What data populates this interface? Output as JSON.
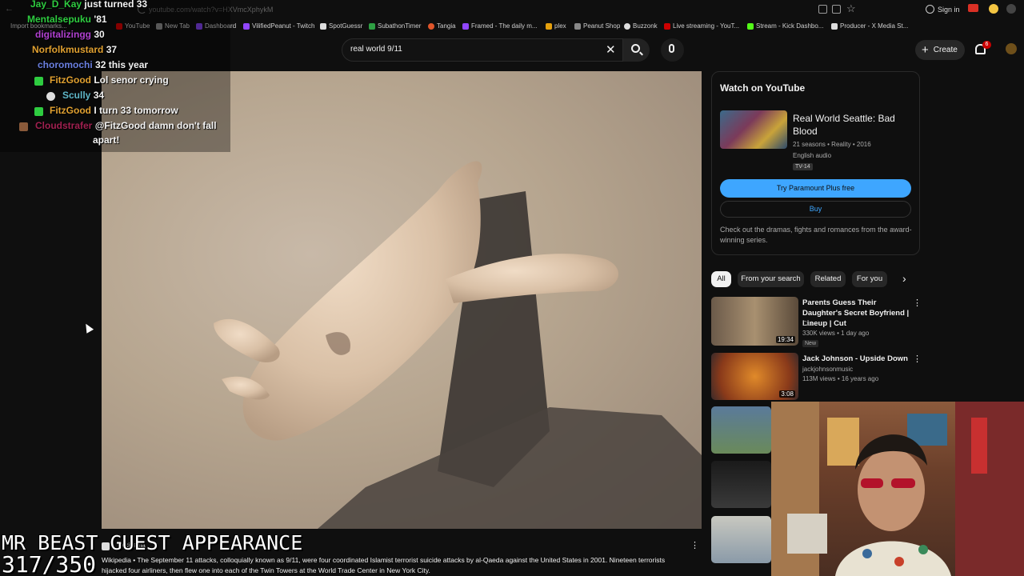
{
  "browser": {
    "url": "youtube.com/watch?v=HXVmcXphykM",
    "signin_label": "Sign in",
    "bookmarks": [
      {
        "label": "Import bookmarks...",
        "color": "#666666"
      },
      {
        "label": "YouTube",
        "color": "#cc0000"
      },
      {
        "label": "New Tab",
        "color": "#888888"
      },
      {
        "label": "Dashboard",
        "color": "#7b3fe4"
      },
      {
        "label": "VilifiedPeanut - Twitch",
        "color": "#9146ff"
      },
      {
        "label": "SpotGuessr",
        "color": "#dddddd"
      },
      {
        "label": "SubathonTimer",
        "color": "#2ea043"
      },
      {
        "label": "Tangia",
        "color": "#e0552a"
      },
      {
        "label": "Framed - The daily m...",
        "color": "#9146ff"
      },
      {
        "label": "plex",
        "color": "#e5a00d"
      },
      {
        "label": "Peanut Shop",
        "color": "#888888"
      },
      {
        "label": "Buzzonk",
        "color": "#dddddd"
      },
      {
        "label": "Live streaming - YouT...",
        "color": "#cc0000"
      },
      {
        "label": "Stream - Kick Dashbo...",
        "color": "#53fc18"
      },
      {
        "label": "Producer - X Media St...",
        "color": "#dddddd"
      }
    ]
  },
  "youtube": {
    "search_value": "real world 9/11",
    "create_label": "Create",
    "notification_count": "6"
  },
  "chat": [
    {
      "user": "Jay_D_Kay",
      "color": "#2ecc40",
      "message": "just turned 33"
    },
    {
      "user": "Mentalsepuku",
      "color": "#2ecc40",
      "message": "'81"
    },
    {
      "user": "digitalizingg",
      "color": "#b040d0",
      "message": "30"
    },
    {
      "user": "Norfolkmustard",
      "color": "#e0a030",
      "message": "37"
    },
    {
      "user": "choromochi",
      "color": "#6a7fe0",
      "message": "32 this year"
    },
    {
      "user": "FitzGood",
      "color": "#e0a030",
      "message": "Lol senor crying"
    },
    {
      "user": "Scully",
      "color": "#5fb6c8",
      "message": "34"
    },
    {
      "user": "FitzGood",
      "color": "#e0a030",
      "message": "I turn 33 tomorrow"
    },
    {
      "user": "Cloudstrafer",
      "color": "#a02050",
      "message": "@FitzGood damn don't fall"
    },
    {
      "user": "",
      "color": "#ffffff",
      "message": "apart!"
    }
  ],
  "watch_card": {
    "heading": "Watch on YouTube",
    "show_title": "Real World Seattle: Bad Blood",
    "meta": "21 seasons • Reality • 2016",
    "audio": "English audio",
    "rating": "TV-14",
    "primary_button": "Try Paramount Plus free",
    "secondary_button": "Buy",
    "description": "Check out the dramas, fights and romances from the award-winning series."
  },
  "chips": [
    "All",
    "From your search",
    "Related",
    "For you"
  ],
  "related": [
    {
      "title": "Parents Guess Their Daughter's Secret Boyfriend | Lineup | Cut",
      "channel": "Cut",
      "views": "330K views • 1 day ago",
      "badge": "New",
      "duration": "19:34"
    },
    {
      "title": "Jack Johnson - Upside Down",
      "channel": "jackjohnsonmusic",
      "views": "113M views • 16 years ago",
      "badge": "",
      "duration": "3:08"
    }
  ],
  "wiki": {
    "source": "Wikipedia",
    "text": "Wikipedia • The September 11 attacks, colloquially known as 9/11, were four coordinated Islamist terrorist suicide attacks by al-Qaeda against the United States in 2001. Nineteen terrorists hijacked four airliners, then flew one into each of the Twin Towers at the World Trade Center in New York City."
  },
  "stream": {
    "title": "MR BEAST GUEST APPEARANCE",
    "count": "317/350"
  },
  "colors": {
    "accent_blue": "#3ea6ff",
    "background": "#0f0f0f",
    "chip_bg": "#272727"
  }
}
